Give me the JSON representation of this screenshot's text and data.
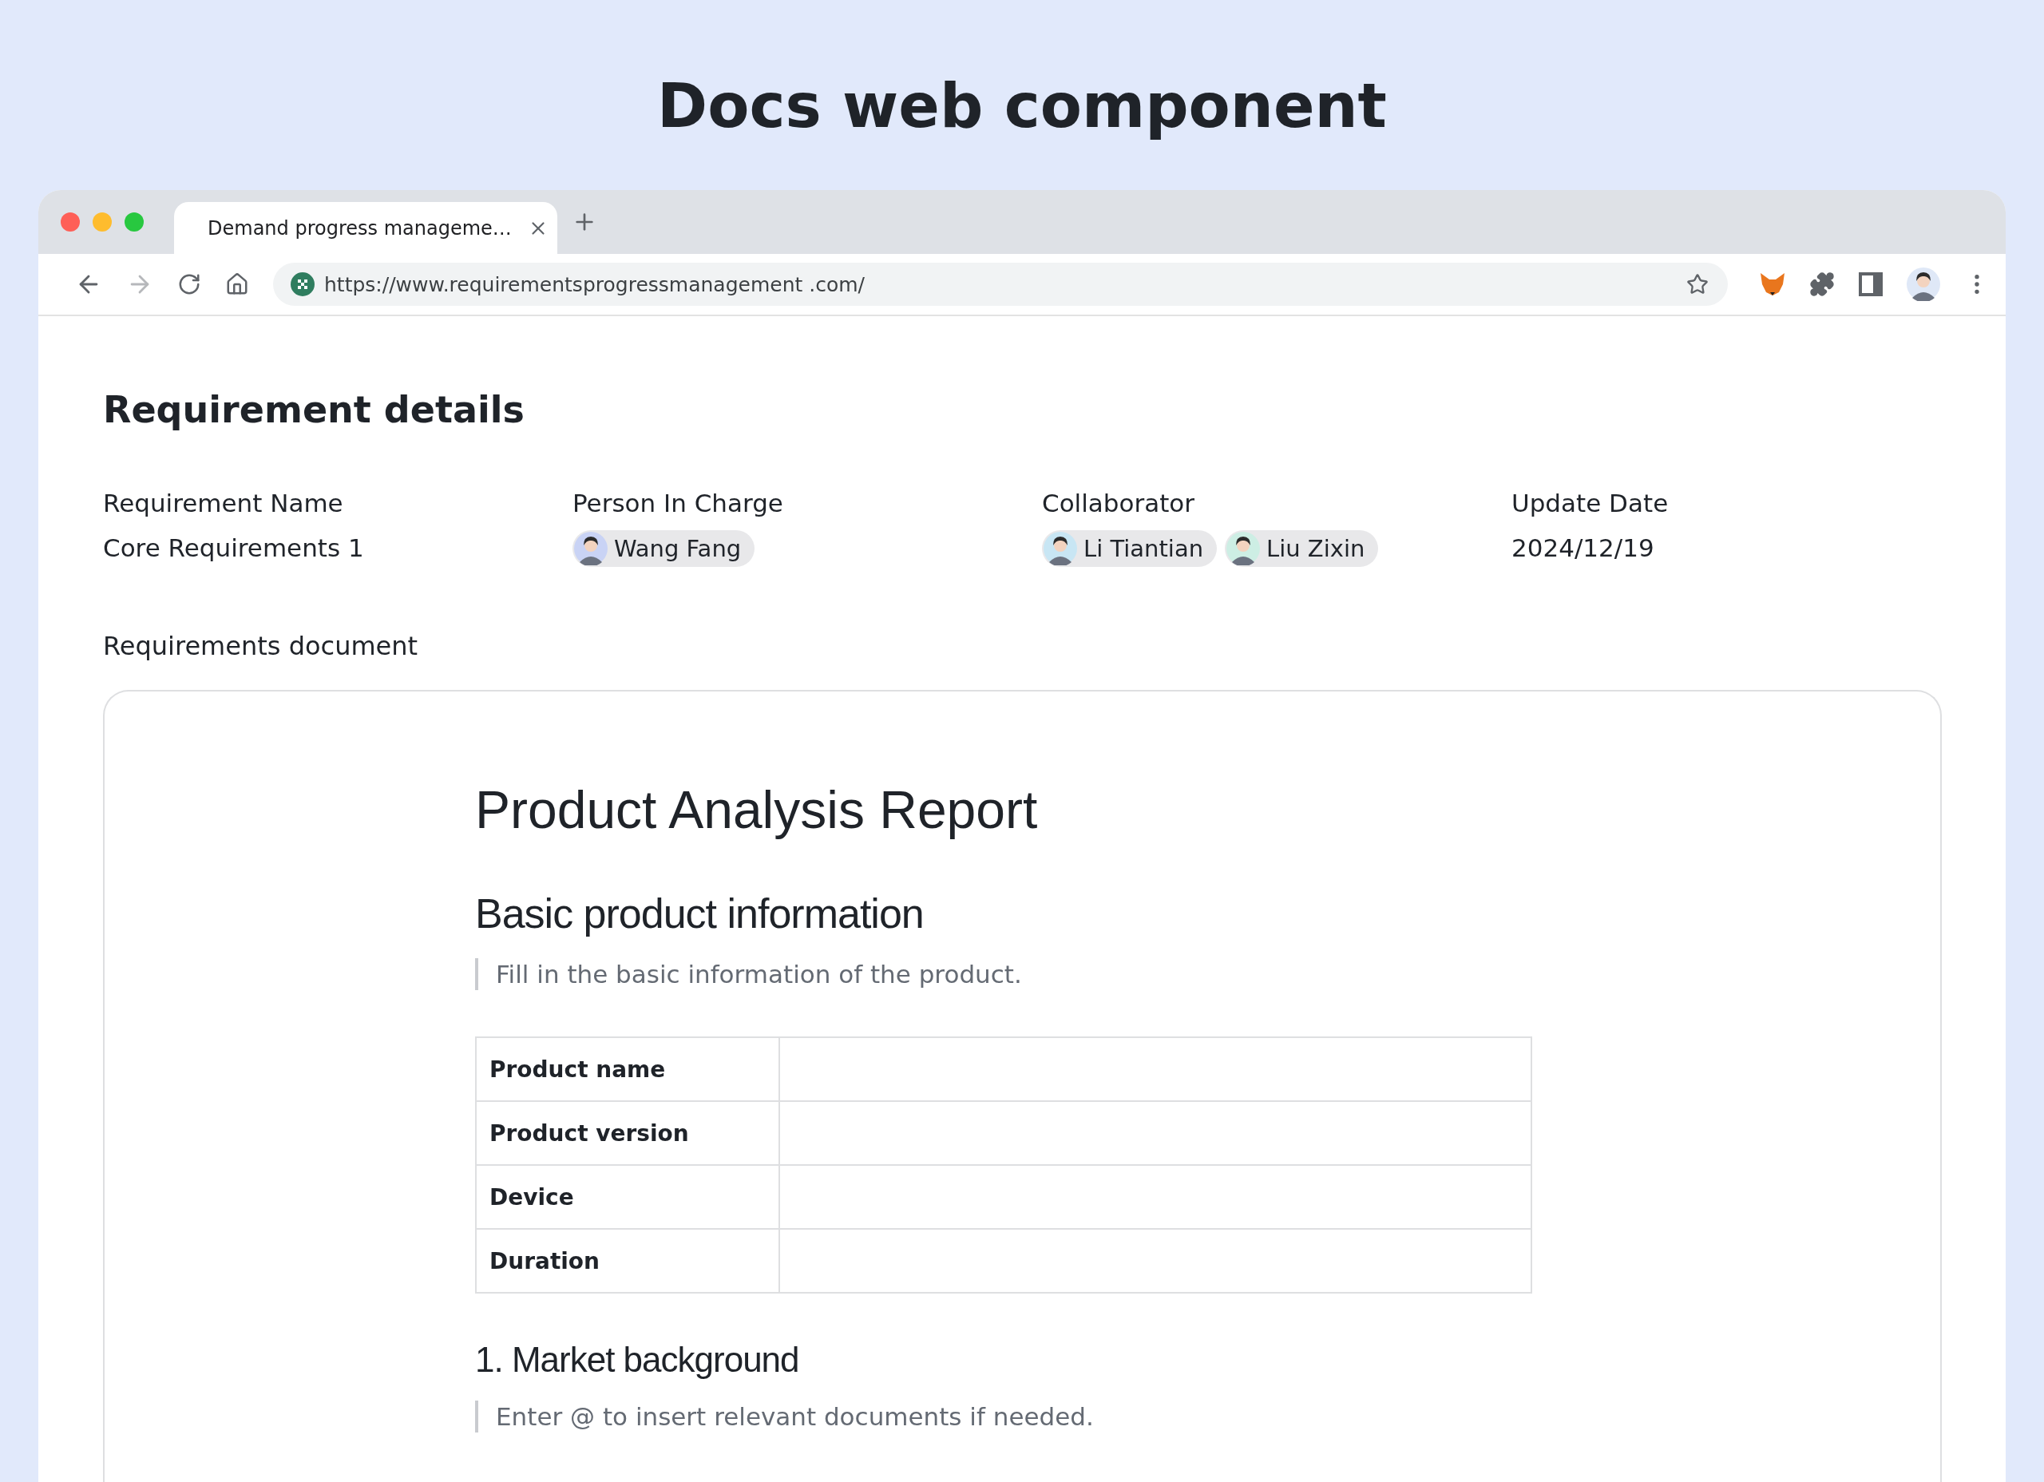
{
  "heading": "Docs web component",
  "browser": {
    "tab_title": "Demand progress manageme…",
    "url": "https://www.requirementsprogressmanagement .com/",
    "forward_disabled": true
  },
  "page_title": "Requirement details",
  "fields": [
    {
      "kind": "text",
      "label": "Requirement Name",
      "value": "Core Requirements 1"
    },
    {
      "kind": "people",
      "label": "Person In Charge",
      "people": [
        {
          "name": "Wang Fang",
          "color": "#c9d3f5"
        }
      ]
    },
    {
      "kind": "people",
      "label": "Collaborator",
      "people": [
        {
          "name": "Li Tiantian",
          "color": "#c8e6f4"
        },
        {
          "name": "Liu Zixin",
          "color": "#cdeee4"
        }
      ]
    },
    {
      "kind": "text",
      "label": "Update Date",
      "value": "2024/12/19"
    }
  ],
  "document_label": "Requirements document",
  "document": {
    "title": "Product Analysis Report",
    "blocks": [
      {
        "kind": "heading",
        "text": "Basic product information"
      },
      {
        "kind": "quote",
        "text": "Fill in the basic information of the product."
      },
      {
        "kind": "table",
        "rows": [
          "Product name",
          "Product version",
          "Device",
          "Duration"
        ]
      },
      {
        "kind": "subheading",
        "text": "1. Market background"
      },
      {
        "kind": "quote",
        "text": "Enter @ to insert relevant documents if needed."
      }
    ]
  }
}
